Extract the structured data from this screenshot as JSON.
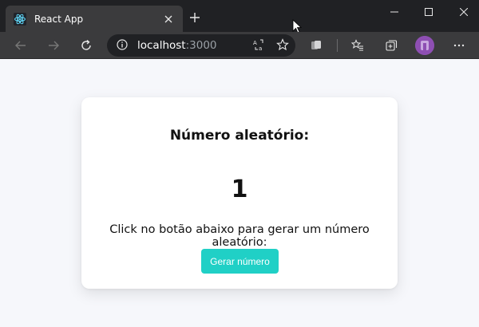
{
  "browser": {
    "tab_title": "React App",
    "url_host": "localhost",
    "url_port": ":3000"
  },
  "icons": {
    "favicon": "react-icon",
    "tab_close": "close-icon",
    "new_tab": "plus-icon",
    "back": "arrow-left-icon",
    "forward": "arrow-right-icon",
    "refresh": "refresh-icon",
    "site_info": "info-icon",
    "read_aloud": "read-aloud-icon",
    "favorite": "star-icon",
    "extensions": "extensions-icon",
    "favorites": "favorites-icon",
    "collections": "collections-icon",
    "profile": "avatar",
    "more": "more-icon"
  },
  "colors": {
    "accent_button": "#20d0c6",
    "page_background": "#f6f7fb",
    "avatar": "#8e4fb3"
  },
  "card": {
    "title": "Número aleatório:",
    "number": "1",
    "instruction": "Click no botão abaixo para gerar um número aleatório:",
    "button_label": "Gerar número"
  }
}
